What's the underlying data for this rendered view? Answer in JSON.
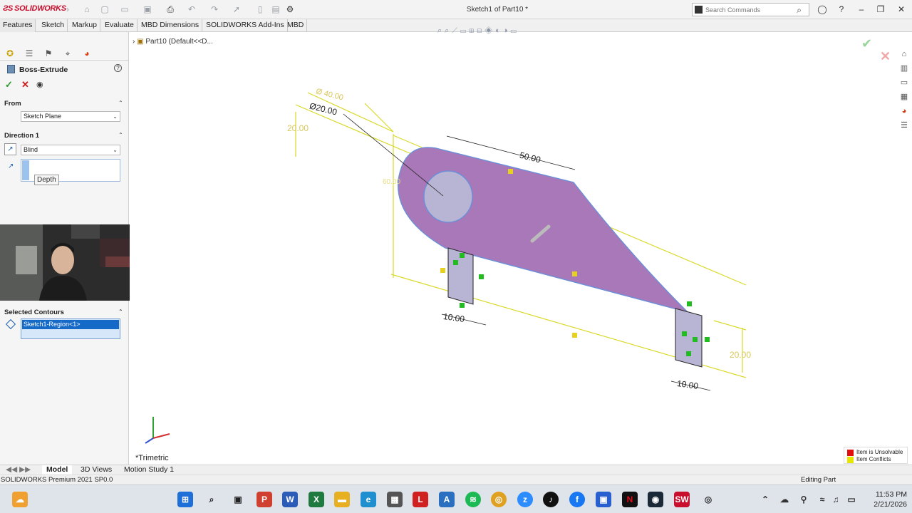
{
  "app": {
    "brand": "SOLIDWORKS",
    "title": "Sketch1 of Part10 *",
    "search_placeholder": "Search Commands"
  },
  "command_tabs": [
    "Features",
    "Sketch",
    "Markup",
    "Evaluate",
    "MBD Dimensions",
    "SOLIDWORKS Add-Ins",
    "MBD"
  ],
  "property_manager": {
    "title": "Boss-Extrude",
    "from_label": "From",
    "from_value": "Sketch Plane",
    "direction_label": "Direction 1",
    "direction_value": "Blind",
    "depth_tooltip": "Depth",
    "selected_contours_label": "Selected Contours",
    "selected_contour_item": "Sketch1-Region<1>"
  },
  "tree": {
    "root_label": "Part10  (Default<<D..."
  },
  "viewport": {
    "view_label": "*Trimetric",
    "dimensions": {
      "d_outer": "Ø 40.00",
      "d_inner": "Ø20.00",
      "offset_left": "20.00",
      "length_top": "50.00",
      "height_vertical": "60.00",
      "thk_left": "10.00",
      "thk_right": "10.00",
      "height_right": "20.00"
    },
    "legend": [
      {
        "label": "Item is Unsolvable",
        "color": "#e01010"
      },
      {
        "label": "Item Conflicts",
        "color": "#e6e600"
      }
    ],
    "part_color": "#a878b8"
  },
  "bottom_tabs": [
    "Model",
    "3D Views",
    "Motion Study 1"
  ],
  "status": {
    "left": "SOLIDWORKS Premium 2021 SP0.0",
    "right": "Editing Part"
  },
  "taskbar": {
    "time": "11:53 PM",
    "date": "2/21/2026"
  }
}
